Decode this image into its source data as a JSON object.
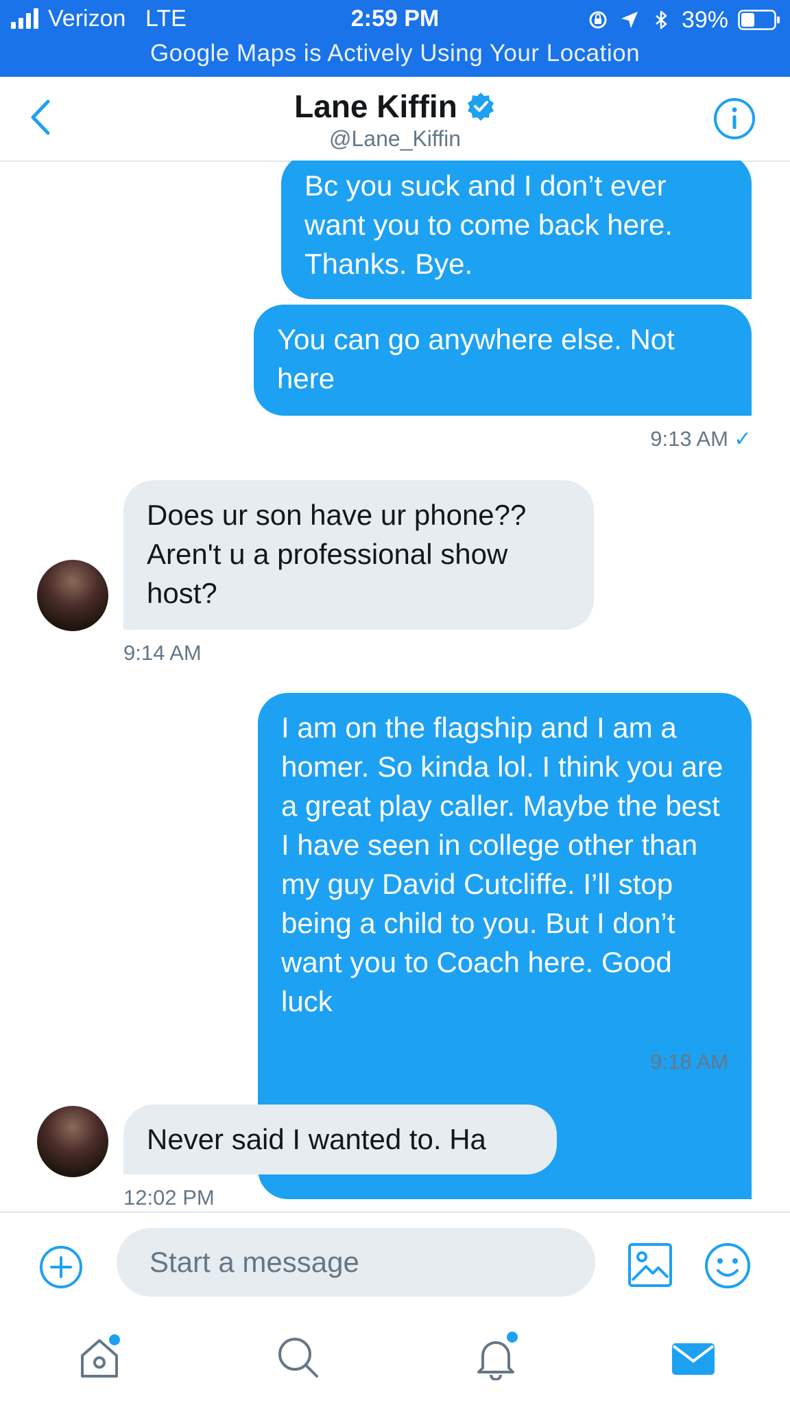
{
  "status_bar": {
    "carrier": "Verizon",
    "network": "LTE",
    "time": "2:59 PM",
    "battery": "39%",
    "banner": "Google Maps is Actively Using Your Location",
    "background_color": "#1a73e8"
  },
  "header": {
    "name": "Lane Kiffin",
    "handle": "@Lane_Kiffin",
    "verified": true
  },
  "messages": [
    {
      "direction": "out",
      "text": "Bc you suck and I don’t ever want you to come back here. Thanks. Bye."
    },
    {
      "direction": "out",
      "text": "You can go anywhere else. Not here",
      "time": "9:13 AM",
      "read": true
    },
    {
      "direction": "in",
      "text": "Does ur son have ur phone?? Aren't u a professional show host?",
      "time": "9:14 AM"
    },
    {
      "direction": "out",
      "text": "I am on the flagship and I am a homer. So kinda lol. I think you are a great play caller. Maybe the best I have seen in college other than my guy David Cutcliffe. I’ll stop being a child to you. But I don’t want you to Coach here. Good luck",
      "time": "9:18 AM",
      "read": true
    },
    {
      "direction": "in",
      "text": "Never said I wanted to.  Ha",
      "time": "12:02 PM"
    }
  ],
  "composer": {
    "placeholder": "Start a message"
  },
  "tabs": [
    {
      "name": "home",
      "icon": "home-icon",
      "badge": true
    },
    {
      "name": "search",
      "icon": "search-icon",
      "badge": false
    },
    {
      "name": "notifications",
      "icon": "bell-icon",
      "badge": true
    },
    {
      "name": "messages",
      "icon": "mail-icon",
      "active": true
    }
  ],
  "colors": {
    "accent": "#1da1f2",
    "incoming_bubble": "#e6ecf0",
    "muted_text": "#657786"
  }
}
